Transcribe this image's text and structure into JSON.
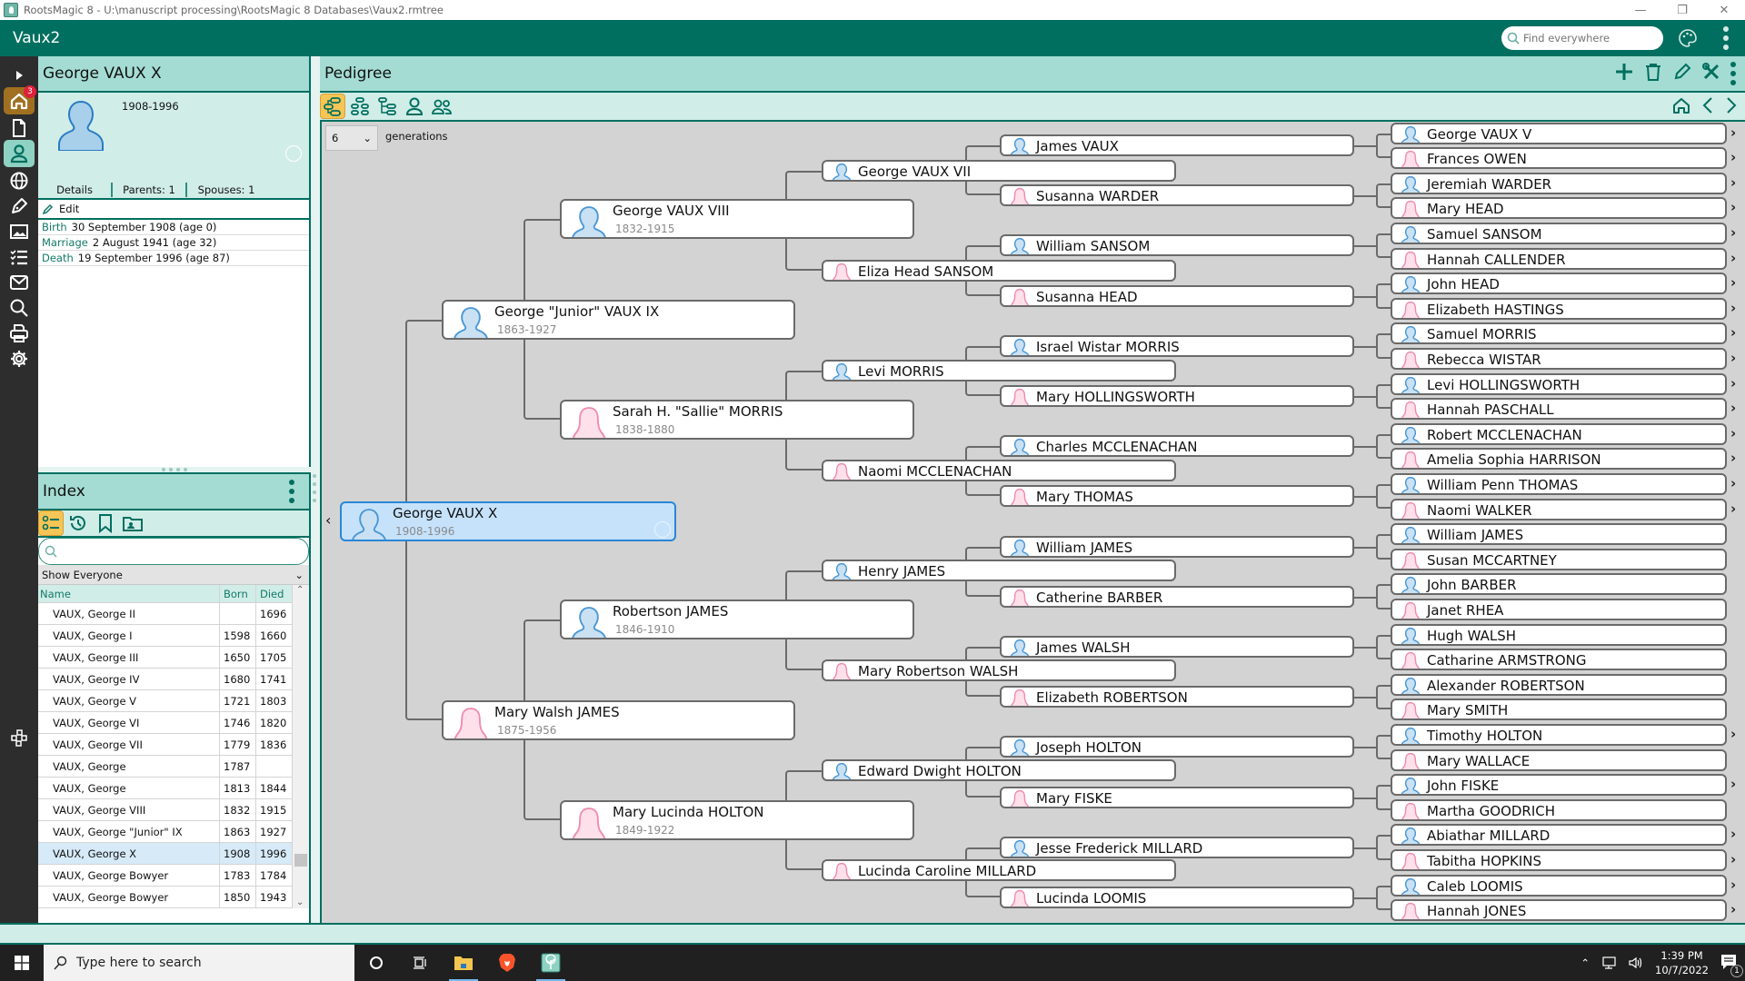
{
  "window": {
    "title": "RootsMagic 8 - U:\\manuscript processing\\RootsMagic 8 Databases\\Vaux2.rmtree",
    "minimize": "—",
    "restore": "❐",
    "close": "✕"
  },
  "appbar": {
    "database_name": "Vaux2",
    "search_placeholder": "Find everywhere",
    "icons": [
      "search-icon",
      "palette-icon",
      "more-vert-icon"
    ]
  },
  "leftnav": {
    "expand_icon": "▶",
    "items": [
      {
        "name": "home",
        "badge": "3"
      },
      {
        "name": "file"
      },
      {
        "name": "people"
      },
      {
        "name": "places"
      },
      {
        "name": "sources"
      },
      {
        "name": "media"
      },
      {
        "name": "tasks"
      },
      {
        "name": "addresses"
      },
      {
        "name": "search"
      },
      {
        "name": "print"
      },
      {
        "name": "settings"
      }
    ],
    "bottom_icon": "family-tree-icon"
  },
  "person": {
    "name": "George VAUX X",
    "dates": "1908-1996",
    "tabs": [
      "Details",
      "Parents: 1",
      "Spouses: 1"
    ],
    "edit_label": "Edit",
    "facts": [
      {
        "type": "Birth",
        "value": "30 September 1908 (age 0)"
      },
      {
        "type": "Marriage",
        "value": "2 August 1941 (age 32)"
      },
      {
        "type": "Death",
        "value": "19 September 1996 (age 87)"
      }
    ]
  },
  "index": {
    "title": "Index",
    "search_placeholder": "",
    "filter": "Show Everyone",
    "columns": [
      "Name",
      "Born",
      "Died"
    ],
    "rows": [
      {
        "name": "VAUX, George II",
        "born": "",
        "died": "1696"
      },
      {
        "name": "VAUX, George I",
        "born": "1598",
        "died": "1660"
      },
      {
        "name": "VAUX, George III",
        "born": "1650",
        "died": "1705"
      },
      {
        "name": "VAUX, George IV",
        "born": "1680",
        "died": "1741"
      },
      {
        "name": "VAUX, George V",
        "born": "1721",
        "died": "1803"
      },
      {
        "name": "VAUX, George VI",
        "born": "1746",
        "died": "1820"
      },
      {
        "name": "VAUX, George VII",
        "born": "1779",
        "died": "1836"
      },
      {
        "name": "VAUX, George",
        "born": "1787",
        "died": ""
      },
      {
        "name": "VAUX, George",
        "born": "1813",
        "died": "1844"
      },
      {
        "name": "VAUX, George VIII",
        "born": "1832",
        "died": "1915"
      },
      {
        "name": "VAUX, George \"Junior\" IX",
        "born": "1863",
        "died": "1927"
      },
      {
        "name": "VAUX, George X",
        "born": "1908",
        "died": "1996",
        "selected": true
      },
      {
        "name": "VAUX, George Bowyer",
        "born": "1783",
        "died": "1784"
      },
      {
        "name": "VAUX, George Bowyer",
        "born": "1850",
        "died": "1943"
      }
    ]
  },
  "pedigree": {
    "title": "Pedigree",
    "generations_value": "6",
    "generations_label": "generations",
    "view_tools": [
      "pedigree-view",
      "family-view",
      "descendants-view",
      "individual-view",
      "people-view"
    ],
    "actions": [
      "add",
      "delete",
      "edit",
      "tools",
      "more"
    ],
    "nav": [
      "home",
      "back",
      "forward"
    ],
    "gen1": {
      "name": "George VAUX X",
      "dates": "1908-1996",
      "sex": "M",
      "selected": true
    },
    "gen2": [
      {
        "name": "George \"Junior\" VAUX IX",
        "dates": "1863-1927",
        "sex": "M"
      },
      {
        "name": "Mary Walsh JAMES",
        "dates": "1875-1956",
        "sex": "F"
      }
    ],
    "gen3": [
      {
        "name": "George VAUX VIII",
        "dates": "1832-1915",
        "sex": "M"
      },
      {
        "name": "Sarah H. \"Sallie\" MORRIS",
        "dates": "1838-1880",
        "sex": "F"
      },
      {
        "name": "Robertson JAMES",
        "dates": "1846-1910",
        "sex": "M"
      },
      {
        "name": "Mary Lucinda HOLTON",
        "dates": "1849-1922",
        "sex": "F"
      }
    ],
    "gen4": [
      {
        "name": "George VAUX VII",
        "sex": "M"
      },
      {
        "name": "Eliza Head SANSOM",
        "sex": "F"
      },
      {
        "name": "Levi MORRIS",
        "sex": "M"
      },
      {
        "name": "Naomi MCCLENACHAN",
        "sex": "F"
      },
      {
        "name": "Henry JAMES",
        "sex": "M"
      },
      {
        "name": "Mary Robertson WALSH",
        "sex": "F"
      },
      {
        "name": "Edward Dwight HOLTON",
        "sex": "M"
      },
      {
        "name": "Lucinda Caroline MILLARD",
        "sex": "F"
      }
    ],
    "gen5": [
      {
        "name": "James VAUX",
        "sex": "M"
      },
      {
        "name": "Susanna WARDER",
        "sex": "F"
      },
      {
        "name": "William SANSOM",
        "sex": "M"
      },
      {
        "name": "Susanna HEAD",
        "sex": "F"
      },
      {
        "name": "Israel Wistar MORRIS",
        "sex": "M"
      },
      {
        "name": "Mary HOLLINGSWORTH",
        "sex": "F"
      },
      {
        "name": "Charles MCCLENACHAN",
        "sex": "M"
      },
      {
        "name": "Mary THOMAS",
        "sex": "F"
      },
      {
        "name": "William JAMES",
        "sex": "M"
      },
      {
        "name": "Catherine BARBER",
        "sex": "F"
      },
      {
        "name": "James WALSH",
        "sex": "M"
      },
      {
        "name": "Elizabeth ROBERTSON",
        "sex": "F"
      },
      {
        "name": "Joseph HOLTON",
        "sex": "M"
      },
      {
        "name": "Mary FISKE",
        "sex": "F"
      },
      {
        "name": "Jesse Frederick MILLARD",
        "sex": "M"
      },
      {
        "name": "Lucinda LOOMIS",
        "sex": "F"
      }
    ],
    "gen6": [
      {
        "name": "George VAUX V",
        "sex": "M",
        "more": true
      },
      {
        "name": "Frances OWEN",
        "sex": "F",
        "more": true
      },
      {
        "name": "Jeremiah WARDER",
        "sex": "M",
        "more": true
      },
      {
        "name": "Mary HEAD",
        "sex": "F",
        "more": true
      },
      {
        "name": "Samuel SANSOM",
        "sex": "M",
        "more": true
      },
      {
        "name": "Hannah CALLENDER",
        "sex": "F",
        "more": true
      },
      {
        "name": "John HEAD",
        "sex": "M",
        "more": true
      },
      {
        "name": "Elizabeth HASTINGS",
        "sex": "F",
        "more": true
      },
      {
        "name": "Samuel MORRIS",
        "sex": "M",
        "more": true
      },
      {
        "name": "Rebecca WISTAR",
        "sex": "F",
        "more": true
      },
      {
        "name": "Levi HOLLINGSWORTH",
        "sex": "M",
        "more": true
      },
      {
        "name": "Hannah PASCHALL",
        "sex": "F",
        "more": true
      },
      {
        "name": "Robert MCCLENACHAN",
        "sex": "M",
        "more": true
      },
      {
        "name": "Amelia Sophia HARRISON",
        "sex": "F",
        "more": true
      },
      {
        "name": "William Penn THOMAS",
        "sex": "M",
        "more": true
      },
      {
        "name": "Naomi WALKER",
        "sex": "F",
        "more": true
      },
      {
        "name": "William JAMES",
        "sex": "M",
        "more": false
      },
      {
        "name": "Susan MCCARTNEY",
        "sex": "F",
        "more": false
      },
      {
        "name": "John BARBER",
        "sex": "M",
        "more": false
      },
      {
        "name": "Janet RHEA",
        "sex": "F",
        "more": false
      },
      {
        "name": "Hugh WALSH",
        "sex": "M",
        "more": false
      },
      {
        "name": "Catharine ARMSTRONG",
        "sex": "F",
        "more": false
      },
      {
        "name": "Alexander ROBERTSON",
        "sex": "M",
        "more": false
      },
      {
        "name": "Mary SMITH",
        "sex": "F",
        "more": false
      },
      {
        "name": "Timothy HOLTON",
        "sex": "M",
        "more": true
      },
      {
        "name": "Mary WALLACE",
        "sex": "F",
        "more": false
      },
      {
        "name": "John FISKE",
        "sex": "M",
        "more": true
      },
      {
        "name": "Martha GOODRICH",
        "sex": "F",
        "more": false
      },
      {
        "name": "Abiathar MILLARD",
        "sex": "M",
        "more": true
      },
      {
        "name": "Tabitha HOPKINS",
        "sex": "F",
        "more": true
      },
      {
        "name": "Caleb LOOMIS",
        "sex": "M",
        "more": true
      },
      {
        "name": "Hannah JONES",
        "sex": "F",
        "more": true
      }
    ]
  },
  "colors": {
    "brand": "#006f5f",
    "header_light": "#a4dcd3",
    "panel_light": "#d1ede8",
    "male": "#4a98d8",
    "male_fill": "#c9e1f3",
    "female": "#f08cb0",
    "female_fill": "#fde0ea",
    "selected": "#c6e2fb"
  },
  "taskbar": {
    "search_placeholder": "Type here to search",
    "time": "1:39 PM",
    "date": "10/7/2022",
    "notifications": "1"
  }
}
